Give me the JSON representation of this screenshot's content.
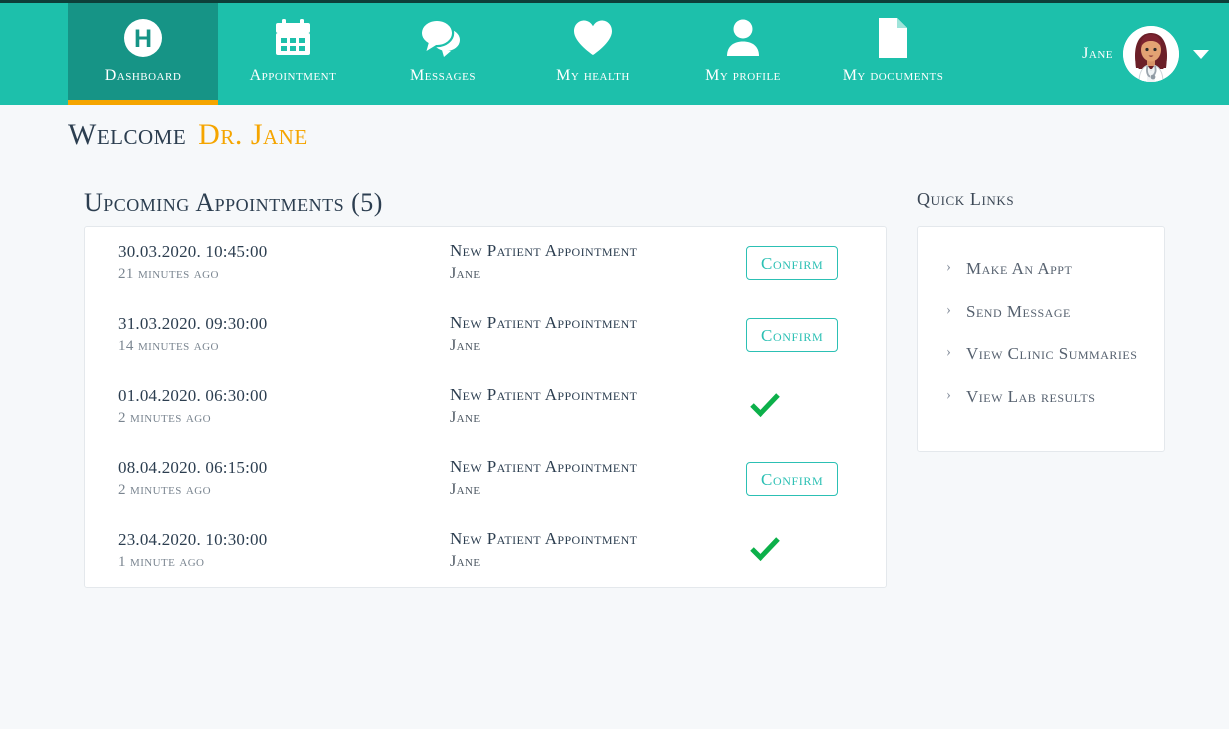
{
  "colors": {
    "nav_background": "#1dc0ab",
    "nav_active": "#169486",
    "accent_orange": "#f5a500",
    "teal": "#2cc0b4",
    "check_green": "#0cb04a",
    "page_background": "#f6f8fa",
    "card_background": "#ffffff"
  },
  "navbar": {
    "items": [
      {
        "label": "Dashboard",
        "icon": "hospital-h-logo-icon",
        "active": true
      },
      {
        "label": "Appointment",
        "icon": "calendar-icon",
        "active": false
      },
      {
        "label": "Messages",
        "icon": "chat-bubbles-icon",
        "active": false
      },
      {
        "label": "My health",
        "icon": "heart-icon",
        "active": false
      },
      {
        "label": "My profile",
        "icon": "person-icon",
        "active": false
      },
      {
        "label": "My documents",
        "icon": "document-icon",
        "active": false
      }
    ],
    "user": {
      "name": "Jane",
      "avatar_icon": "doctor-avatar",
      "caret_icon": "chevron-down-icon"
    }
  },
  "welcome": {
    "greeting": "Welcome",
    "user": "Dr. Jane"
  },
  "appointments": {
    "title": "Upcoming Appointments (5)",
    "confirm_label": "Confirm",
    "confirmed_icon": "green-check-icon",
    "rows": [
      {
        "date": "30.03.2020. 10:45:00",
        "ago": "21 minutes ago",
        "type": "New Patient Appointment",
        "person": "Jane",
        "status": "pending"
      },
      {
        "date": "31.03.2020. 09:30:00",
        "ago": "14 minutes ago",
        "type": "New Patient Appointment",
        "person": "Jane",
        "status": "pending"
      },
      {
        "date": "01.04.2020. 06:30:00",
        "ago": "2 minutes ago",
        "type": "New Patient Appointment",
        "person": "Jane",
        "status": "confirmed"
      },
      {
        "date": "08.04.2020. 06:15:00",
        "ago": "2 minutes ago",
        "type": "New Patient Appointment",
        "person": "Jane",
        "status": "pending"
      },
      {
        "date": "23.04.2020. 10:30:00",
        "ago": "1 minute ago",
        "type": "New Patient Appointment",
        "person": "Jane",
        "status": "confirmed"
      }
    ]
  },
  "quick_links": {
    "title": "Quick Links",
    "chevron": "›",
    "items": [
      {
        "label": "Make An Appt"
      },
      {
        "label": "Send Message"
      },
      {
        "label": "View Clinic Summaries"
      },
      {
        "label": "View Lab results"
      }
    ]
  }
}
